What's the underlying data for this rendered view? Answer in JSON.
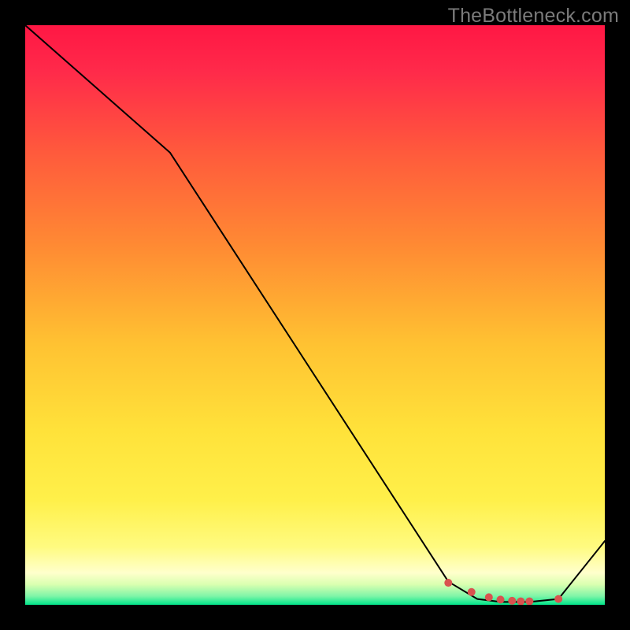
{
  "watermark": "TheBottleneck.com",
  "chart_data": {
    "type": "line",
    "title": "",
    "xlabel": "",
    "ylabel": "",
    "xlim": [
      0,
      100
    ],
    "ylim": [
      0,
      100
    ],
    "grid": false,
    "legend": false,
    "series": [
      {
        "name": "curve",
        "stroke": "#000000",
        "stroke_width": 2,
        "x": [
          0,
          25,
          73,
          78,
          82,
          85,
          87,
          92,
          100
        ],
        "y": [
          100,
          78,
          4,
          1,
          0.5,
          0.5,
          0.5,
          1,
          11
        ]
      },
      {
        "name": "markers",
        "type": "scatter",
        "fill": "#d9534f",
        "radius": 5,
        "x": [
          73,
          77,
          80,
          82,
          84,
          85.5,
          87,
          92
        ],
        "y": [
          3.8,
          2.2,
          1.3,
          0.9,
          0.7,
          0.6,
          0.6,
          1.0
        ]
      }
    ],
    "background_gradient": {
      "stops": [
        {
          "offset": 0,
          "color": "#ff1744"
        },
        {
          "offset": 0.08,
          "color": "#ff2a4a"
        },
        {
          "offset": 0.22,
          "color": "#ff5a3c"
        },
        {
          "offset": 0.38,
          "color": "#ff8a33"
        },
        {
          "offset": 0.55,
          "color": "#ffc232"
        },
        {
          "offset": 0.7,
          "color": "#ffe23a"
        },
        {
          "offset": 0.82,
          "color": "#fff04a"
        },
        {
          "offset": 0.9,
          "color": "#fffb80"
        },
        {
          "offset": 0.945,
          "color": "#ffffcc"
        },
        {
          "offset": 0.965,
          "color": "#d9ffb0"
        },
        {
          "offset": 0.985,
          "color": "#7ff5a8"
        },
        {
          "offset": 1.0,
          "color": "#00e58a"
        }
      ]
    }
  }
}
